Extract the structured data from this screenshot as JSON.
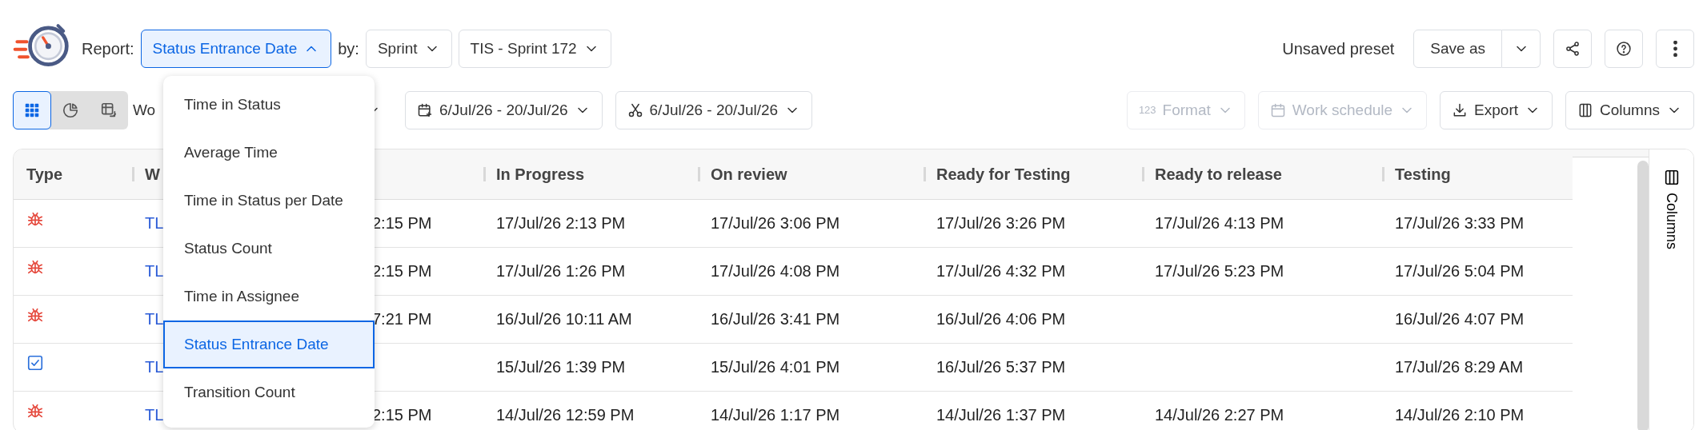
{
  "header": {
    "report_label": "Report:",
    "report_select": {
      "label": "Status Entrance Date",
      "expanded": true
    },
    "by_label": "by:",
    "group_select": "Sprint",
    "sprint_select": "TIS - Sprint 172",
    "preset": "Unsaved preset",
    "save_button": "Save as"
  },
  "view_toggles": [
    {
      "kind": "grid",
      "selected": true
    },
    {
      "kind": "chart",
      "selected": false
    },
    {
      "kind": "pivot",
      "selected": false
    }
  ],
  "toolbar": [
    {
      "kind": "select",
      "label": "Wo",
      "disabled": false
    },
    {
      "kind": "calendar",
      "label": "6/Jul/26 - 20/Jul/26",
      "disabled": false
    },
    {
      "kind": "scissors",
      "label": "6/Jul/26 - 20/Jul/26",
      "disabled": false
    },
    {
      "kind": "format",
      "glyph": "123",
      "label": "Format",
      "disabled": true
    },
    {
      "kind": "schedule",
      "label": "Work schedule",
      "disabled": true
    },
    {
      "kind": "export",
      "label": "Export",
      "disabled": false
    },
    {
      "kind": "columns",
      "label": "Columns",
      "disabled": false
    }
  ],
  "report_menu": [
    {
      "label": "Time in Status",
      "selected": false
    },
    {
      "label": "Average Time",
      "selected": false
    },
    {
      "label": "Time in Status per Date",
      "selected": false
    },
    {
      "label": "Status Count",
      "selected": false
    },
    {
      "label": "Time in Assignee",
      "selected": false
    },
    {
      "label": "Status Entrance Date",
      "selected": true
    },
    {
      "label": "Transition Count",
      "selected": false
    }
  ],
  "table": {
    "columns": [
      {
        "label": "Type"
      },
      {
        "label": "W"
      },
      {},
      {
        "label": "In Progress"
      },
      {
        "label": "On review"
      },
      {
        "label": "Ready for Testing"
      },
      {
        "label": "Ready to release"
      },
      {
        "label": "Testing"
      }
    ],
    "rows": [
      {
        "kind": "bug",
        "cells": [
          "",
          "TL",
          "2:15 PM",
          "17/Jul/26 2:13 PM",
          "17/Jul/26 3:06 PM",
          "17/Jul/26 3:26 PM",
          "17/Jul/26 4:13 PM",
          "17/Jul/26 3:33 PM"
        ]
      },
      {
        "kind": "bug",
        "cells": [
          "",
          "TL",
          "2:15 PM",
          "17/Jul/26 1:26 PM",
          "17/Jul/26 4:08 PM",
          "17/Jul/26 4:32 PM",
          "17/Jul/26 5:23 PM",
          "17/Jul/26 5:04 PM"
        ]
      },
      {
        "kind": "bug",
        "cells": [
          "",
          "TL",
          "7:21 PM",
          "16/Jul/26 10:11 AM",
          "16/Jul/26 3:41 PM",
          "16/Jul/26 4:06 PM",
          "",
          "16/Jul/26 4:07 PM"
        ]
      },
      {
        "kind": "task",
        "cells": [
          "",
          "TL",
          "",
          "15/Jul/26 1:39 PM",
          "15/Jul/26 4:01 PM",
          "16/Jul/26 5:37 PM",
          "",
          "17/Jul/26 8:29 AM"
        ]
      },
      {
        "kind": "bug",
        "cells": [
          "",
          "TL",
          "2:15 PM",
          "14/Jul/26 12:59 PM",
          "14/Jul/26 1:17 PM",
          "14/Jul/26 1:37 PM",
          "14/Jul/26 2:27 PM",
          "14/Jul/26 2:10 PM"
        ]
      }
    ]
  },
  "side_panel": {
    "label": "Columns"
  }
}
